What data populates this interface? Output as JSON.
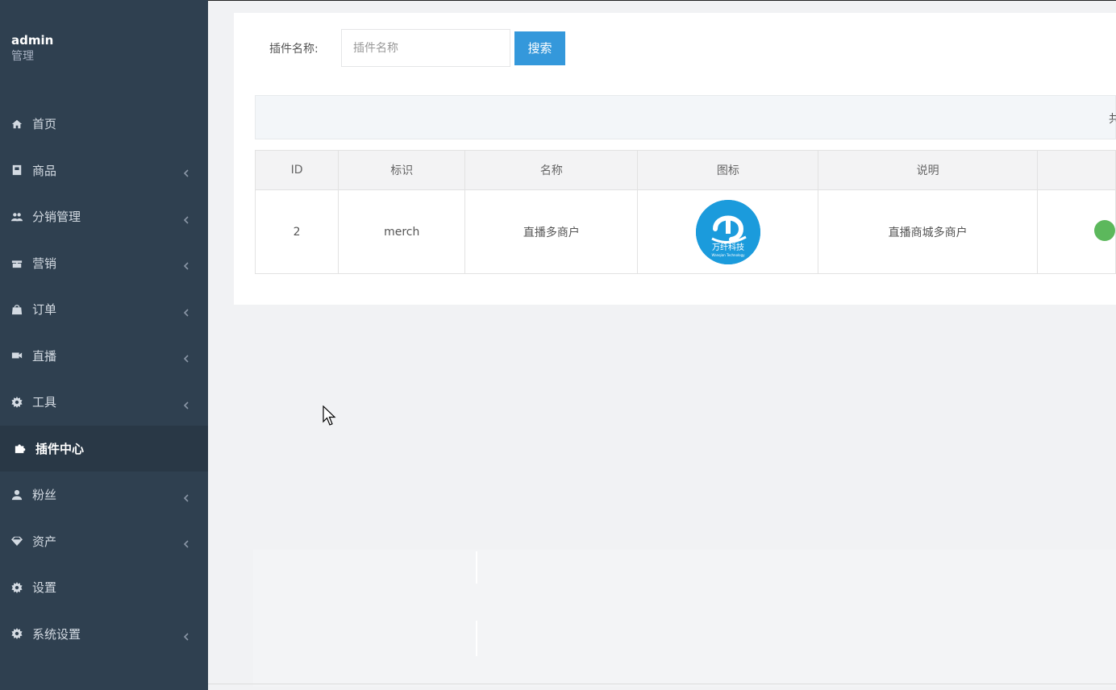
{
  "user": {
    "name": "admin",
    "role": "管理"
  },
  "sidebar": {
    "items": [
      {
        "label": "首页",
        "icon": "home-icon",
        "arrow": false,
        "active": false
      },
      {
        "label": "商品",
        "icon": "product-icon",
        "arrow": true,
        "active": false
      },
      {
        "label": "分销管理",
        "icon": "users-icon",
        "arrow": true,
        "active": false
      },
      {
        "label": "营销",
        "icon": "gift-icon",
        "arrow": true,
        "active": false
      },
      {
        "label": "订单",
        "icon": "shopping-bag-icon",
        "arrow": true,
        "active": false
      },
      {
        "label": "直播",
        "icon": "video-camera-icon",
        "arrow": true,
        "active": false
      },
      {
        "label": "工具",
        "icon": "gear-icon",
        "arrow": true,
        "active": false
      },
      {
        "label": "插件中心",
        "icon": "puzzle-icon",
        "arrow": false,
        "active": true
      },
      {
        "label": "粉丝",
        "icon": "user-icon",
        "arrow": true,
        "active": false
      },
      {
        "label": "资产",
        "icon": "diamond-icon",
        "arrow": true,
        "active": false
      },
      {
        "label": "设置",
        "icon": "gear-icon",
        "arrow": false,
        "active": false
      },
      {
        "label": "系统设置",
        "icon": "gear-icon",
        "arrow": true,
        "active": false
      }
    ]
  },
  "search": {
    "label": "插件名称:",
    "placeholder": "插件名称",
    "value": "",
    "button": "搜索"
  },
  "info_bar": {
    "total_text": "共"
  },
  "table": {
    "columns": [
      "ID",
      "标识",
      "名称",
      "图标",
      "说明",
      ""
    ],
    "rows": [
      {
        "id": "2",
        "identifier": "merch",
        "name": "直播多商户",
        "icon_text": "万纤科技",
        "icon_subtext": "Wanqian Technology",
        "description": "直播商城多商户",
        "status": ""
      }
    ]
  },
  "colors": {
    "sidebar_bg": "#2f4050",
    "sidebar_active_bg": "#293846",
    "accent": "#3498db",
    "status_green": "#5cb85c",
    "logo_blue": "#1b9bdc"
  }
}
